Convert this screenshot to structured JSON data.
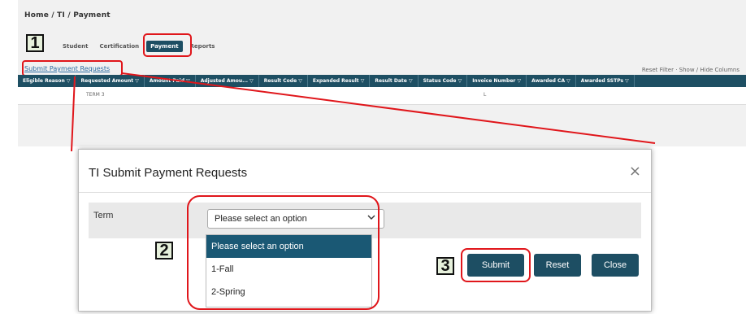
{
  "breadcrumb": "Home / TI / Payment",
  "steps": {
    "one": "1",
    "two": "2",
    "three": "3"
  },
  "tabs": [
    {
      "label": "Student"
    },
    {
      "label": "Certification"
    },
    {
      "label": "Payment"
    },
    {
      "label": "Reports"
    }
  ],
  "toolbar": {
    "submit_link": "Submit Payment Requests",
    "right_actions": "Reset Filter · Show / Hide Columns"
  },
  "grid": {
    "columns": [
      "Eligible Reason ▽",
      "Requested Amount ▽",
      "Amount Paid ▽",
      "Adjusted Amou... ▽",
      "Result Code ▽",
      "Expanded Result ▽",
      "Result Date ▽",
      "Status Code ▽",
      "Invoice Number ▽",
      "Awarded CA ▽",
      "Awarded SSTPs ▽"
    ],
    "row": {
      "cell_a": "TERM 3",
      "cell_b": "L"
    }
  },
  "modal": {
    "title": "TI Submit Payment Requests",
    "close_symbol": "×",
    "term_label": "Term",
    "select_value": "Please select an option",
    "options": [
      "Please select an option",
      "1-Fall",
      "2-Spring"
    ],
    "buttons": {
      "submit": "Submit",
      "reset": "Reset",
      "close": "Close"
    }
  },
  "colors": {
    "primary": "#1d4e63",
    "highlight": "#e0161b",
    "badge_bg": "#e7f1dc"
  }
}
